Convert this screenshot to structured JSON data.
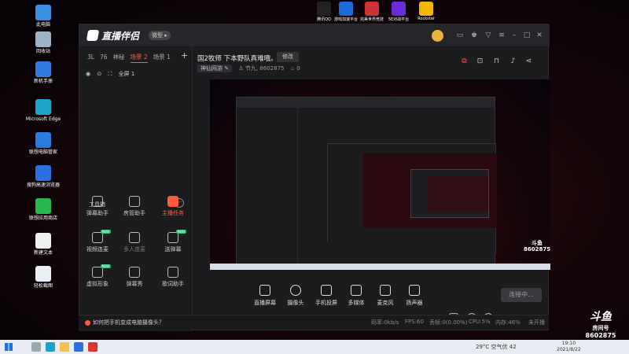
{
  "desktop_icons": [
    {
      "label": "此电脑",
      "color": "#3b8fe0"
    },
    {
      "label": "回收站",
      "color": "#9fb3c8"
    },
    {
      "label": "新机手册",
      "color": "#2f7de1"
    },
    {
      "label": "Microsoft Edge",
      "color": "#1fa4c8"
    },
    {
      "label": "联想电脑管家",
      "color": "#2a7be0"
    },
    {
      "label": "搜狗高速浏览器",
      "color": "#2c6fe0"
    },
    {
      "label": "联想应用商店",
      "color": "#2bb64d"
    },
    {
      "label": "新建文本",
      "color": "#f0f0f0"
    },
    {
      "label": "轻松截图",
      "color": "#e9eef5"
    }
  ],
  "top_icons": [
    {
      "label": "腾讯QQ",
      "color": "#222"
    },
    {
      "label": "游戏加速平台",
      "color": "#1d6bd8"
    },
    {
      "label": "完美世界竞技",
      "color": "#c33"
    },
    {
      "label": "5E对战平台",
      "color": "#6a2bd8"
    },
    {
      "label": "Rockstar",
      "color": "#f2b600"
    }
  ],
  "app": {
    "name": "直播伴侣",
    "version_badge": "微型 ▸",
    "scene_tabs": [
      "3L",
      "76",
      "神秘",
      "场景 2",
      "场景 1"
    ],
    "active_scene": "场景 2",
    "add_scene": "+",
    "layer_label": "全屏 1",
    "toolbox_title": "工具箱",
    "more": "···",
    "tools": [
      {
        "label": "弹幕助手",
        "style": "normal",
        "tag": ""
      },
      {
        "label": "房管助手",
        "style": "normal",
        "tag": ""
      },
      {
        "label": "主播任务",
        "style": "red",
        "tag": ""
      },
      {
        "label": "视频连麦",
        "style": "normal",
        "tag": "NEW"
      },
      {
        "label": "多人连麦",
        "style": "dim",
        "tag": ""
      },
      {
        "label": "送弹幕",
        "style": "normal",
        "tag": "NEW"
      },
      {
        "label": "虚拟形象",
        "style": "normal",
        "tag": "NEW"
      },
      {
        "label": "弹幕秀",
        "style": "normal",
        "tag": ""
      },
      {
        "label": "歌词助手",
        "style": "normal",
        "tag": ""
      }
    ],
    "room_title": "国2牧师 下本野队真难哦。",
    "edit_label": "修改",
    "category": "神仙网游 ✎",
    "streamer": "节九",
    "room_id": "8602875",
    "hot": "0",
    "controls": [
      "直播屏幕",
      "摄像头",
      "手机投屏",
      "多媒体",
      "麦克风",
      "扬声器"
    ],
    "live_button": "连接中...",
    "hint": "如何把手机变成电脑摄像头？",
    "stats": {
      "bitrate": "码率:0kb/s",
      "fps": "FPS:60",
      "drop": "丢帧:0(0.00%)",
      "cpu": "CPU:5%",
      "mem": "内存:46%",
      "state": "未开播"
    }
  },
  "watermark": {
    "brand": "斗鱼",
    "sub": "房间号",
    "room": "8602875"
  },
  "taskbar": {
    "weather": "29°C 空气优 42",
    "time": "19:10",
    "date": "2021/8/22"
  }
}
